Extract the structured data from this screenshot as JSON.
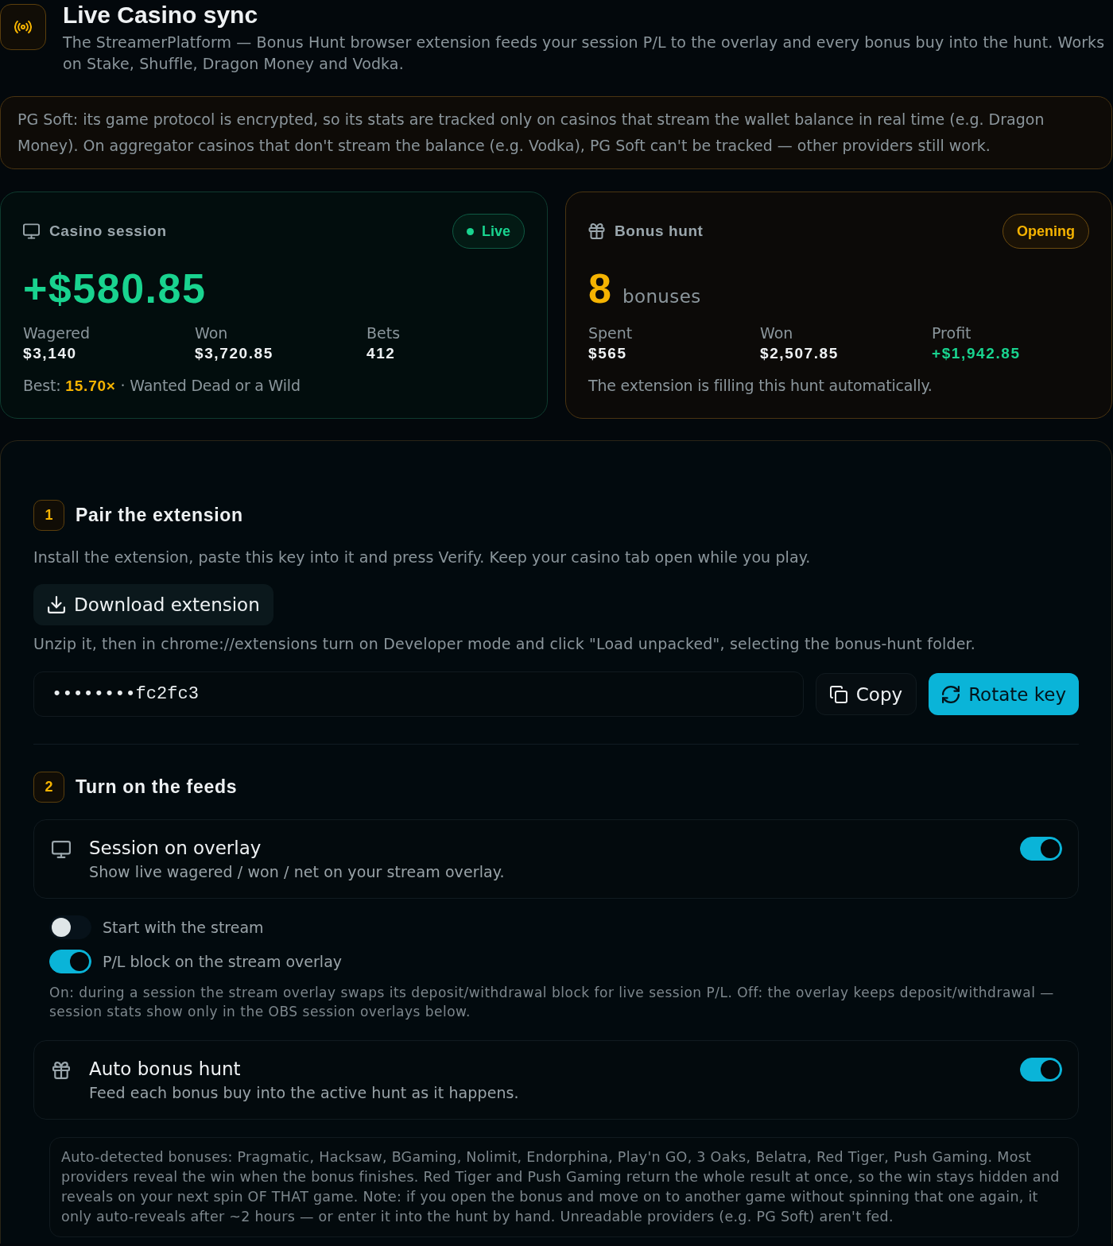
{
  "header": {
    "title": "Live Casino sync",
    "description": "The StreamerPlatform — Bonus Hunt browser extension feeds your session P/L to the overlay and every bonus buy into the hunt. Works on Stake, Shuffle, Dragon Money and Vodka."
  },
  "notice": "PG Soft: its game protocol is encrypted, so its stats are tracked only on casinos that stream the wallet balance in real time (e.g. Dragon Money). On aggregator casinos that don't stream the balance (e.g. Vodka), PG Soft can't be tracked — other providers still work.",
  "cards": [
    {
      "kind": "session",
      "title": "Casino session",
      "status": {
        "kind": "live",
        "label": "Live"
      },
      "net": "+$580.85",
      "stats": [
        {
          "label": "Wagered",
          "value": "$3,140",
          "positive": false
        },
        {
          "label": "Won",
          "value": "$3,720.85",
          "positive": false
        },
        {
          "label": "Bets",
          "value": "412",
          "positive": false
        }
      ],
      "footer": "Best: **15.70×** · Wanted Dead or a Wild"
    },
    {
      "kind": "hunt",
      "title": "Bonus hunt",
      "status": {
        "kind": "opening",
        "label": "Opening"
      },
      "count": "8",
      "count_label": "bonuses",
      "stats": [
        {
          "label": "Spent",
          "value": "$565",
          "positive": false
        },
        {
          "label": "Won",
          "value": "$2,507.85",
          "positive": false
        },
        {
          "label": "Profit",
          "value": "+$1,942.85",
          "positive": true
        }
      ],
      "footer": "The extension is filling this hunt automatically."
    }
  ],
  "steps": [
    {
      "kind": "pair",
      "number": "1",
      "title": "Pair the extension",
      "description": "Install the extension, paste this key into it and press Verify. Keep your casino tab open while you play.",
      "download_button": "Download extension",
      "note": "Unzip it, then in chrome://extensions turn on Developer mode and click \"Load unpacked\", selecting the bonus-hunt folder.",
      "key_field": {
        "value": "••••••••fc2fc3"
      },
      "copy_button": "Copy",
      "rotate_button": "Rotate key"
    },
    {
      "kind": "feeds",
      "number": "2",
      "title": "Turn on the feeds",
      "feeds": [
        {
          "kind": "session",
          "title": "Session on overlay",
          "description": "Show live wagered / won / net on your stream overlay.",
          "on": true,
          "options": [
            {
              "label": "Start with the stream",
              "on": false
            },
            {
              "label": "P/L block on the stream overlay",
              "on": true
            }
          ],
          "note": "On: during a session the stream overlay swaps its deposit/withdrawal block for live session P/L. Off: the overlay keeps deposit/withdrawal — session stats show only in the OBS session overlays below."
        },
        {
          "kind": "hunt",
          "title": "Auto bonus hunt",
          "description": "Feed each bonus buy into the active hunt as it happens.",
          "on": true,
          "note": "Auto-detected bonuses: Pragmatic, Hacksaw, BGaming, Nolimit, Endorphina, Play'n GO, 3 Oaks, Belatra, Red Tiger, Push Gaming. Most providers reveal the win when the bonus finishes. Red Tiger and Push Gaming return the whole result at once, so the win stays hidden and reveals on your next spin OF THAT game. Note: if you open the bonus and move on to another game without spinning that one again, it only auto-reveals after ~2 hours — or enter it into the hunt by hand. Unreadable providers (e.g. PG Soft) aren't fed."
        }
      ]
    }
  ]
}
